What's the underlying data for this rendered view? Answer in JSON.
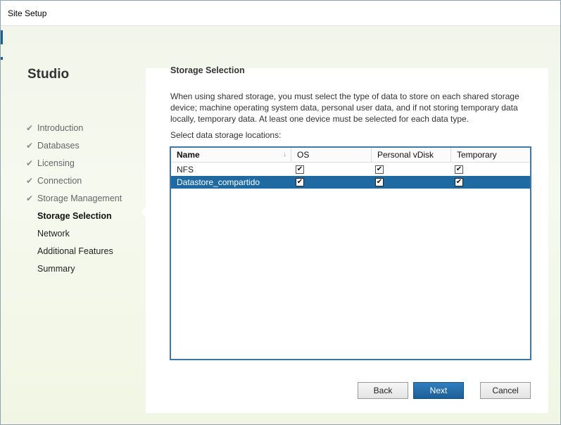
{
  "window": {
    "title": "Site Setup"
  },
  "brand": "Studio",
  "steps": [
    {
      "label": "Introduction",
      "state": "done"
    },
    {
      "label": "Databases",
      "state": "done"
    },
    {
      "label": "Licensing",
      "state": "done"
    },
    {
      "label": "Connection",
      "state": "done"
    },
    {
      "label": "Storage Management",
      "state": "done"
    },
    {
      "label": "Storage Selection",
      "state": "active"
    },
    {
      "label": "Network",
      "state": "todo"
    },
    {
      "label": "Additional Features",
      "state": "todo"
    },
    {
      "label": "Summary",
      "state": "todo"
    }
  ],
  "check_glyph": "✔",
  "panel": {
    "title": "Storage Selection",
    "description": "When using shared storage, you must select the type of data to store on each shared storage device; machine operating system data, personal user data, and if not storing temporary data locally, temporary data. At least one device must be selected for each data type.",
    "select_label": "Select data storage locations:"
  },
  "grid": {
    "columns": [
      "Name",
      "OS",
      "Personal vDisk",
      "Temporary"
    ],
    "sort_icon": "↓",
    "rows": [
      {
        "name": "NFS",
        "os": true,
        "personal_vdisk": true,
        "temporary": true,
        "selected": false
      },
      {
        "name": "Datastore_compartido",
        "os": true,
        "personal_vdisk": true,
        "temporary": true,
        "selected": true
      }
    ]
  },
  "buttons": {
    "back": "Back",
    "next": "Next",
    "cancel": "Cancel"
  },
  "colors": {
    "accent": "#1f6aa1",
    "primary_button": "#2373b3"
  }
}
